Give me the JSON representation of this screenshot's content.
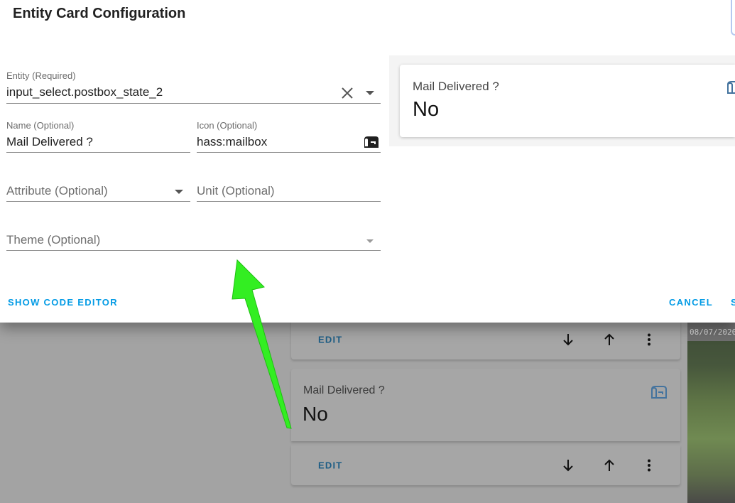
{
  "dialog": {
    "title": "Entity Card Configuration",
    "fields": {
      "entity": {
        "label": "Entity (Required)",
        "value": "input_select.postbox_state_2"
      },
      "name": {
        "label": "Name (Optional)",
        "value": "Mail Delivered ?"
      },
      "icon": {
        "label": "Icon (Optional)",
        "value": "hass:mailbox",
        "icon": "mailbox-icon"
      },
      "attribute": {
        "placeholder": "Attribute (Optional)"
      },
      "unit": {
        "placeholder": "Unit (Optional)"
      },
      "theme": {
        "placeholder": "Theme (Optional)"
      }
    },
    "preview": {
      "name": "Mail Delivered ?",
      "state": "No"
    },
    "buttons": {
      "show_code_editor": "SHOW CODE EDITOR",
      "cancel": "CANCEL",
      "save_partial": "S"
    }
  },
  "background": {
    "cards": [
      {
        "edit_label": "EDIT"
      },
      {
        "name": "Mail Delivered ?",
        "state": "No",
        "edit_label": "EDIT"
      }
    ],
    "camera": {
      "timestamp": "08/07/2020"
    }
  },
  "icons": [
    "close-icon",
    "chevron-down-icon",
    "mailbox-icon",
    "arrow-down-icon",
    "arrow-up-icon",
    "more-vertical-icon"
  ],
  "colors": {
    "accent": "#039be5",
    "edit_text": "#1d5d85",
    "mail_icon": "#44739e",
    "annotation_arrow": "#33ee22"
  }
}
